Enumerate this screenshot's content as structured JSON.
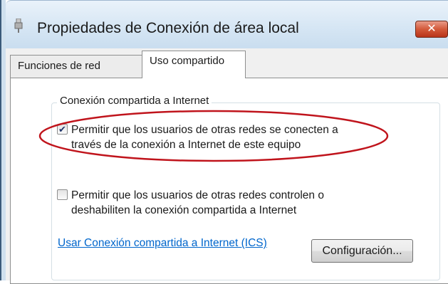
{
  "window": {
    "title": "Propiedades de Conexión de área local",
    "icon": "network-adapter-icon",
    "close_glyph": "✕"
  },
  "tabs": [
    {
      "label": "Funciones de red",
      "active": false
    },
    {
      "label": "Uso compartido",
      "active": true
    }
  ],
  "group": {
    "label": "Conexión compartida a Internet"
  },
  "options": [
    {
      "line1": "Permitir que los usuarios de otras redes se conecten a",
      "line2": "través de la conexión a Internet de este equipo",
      "checked": true
    },
    {
      "line1": "Permitir que los usuarios de otras redes controlen o",
      "line2": "deshabiliten la conexión compartida a Internet",
      "checked": false
    }
  ],
  "link": {
    "label": "Usar Conexión compartida a Internet (ICS)"
  },
  "buttons": {
    "settings_label": "Configuración..."
  },
  "annotation": {
    "highlight_color": "#c0141c"
  },
  "colors": {
    "link": "#0066cc",
    "close_button": "#c8472a"
  }
}
